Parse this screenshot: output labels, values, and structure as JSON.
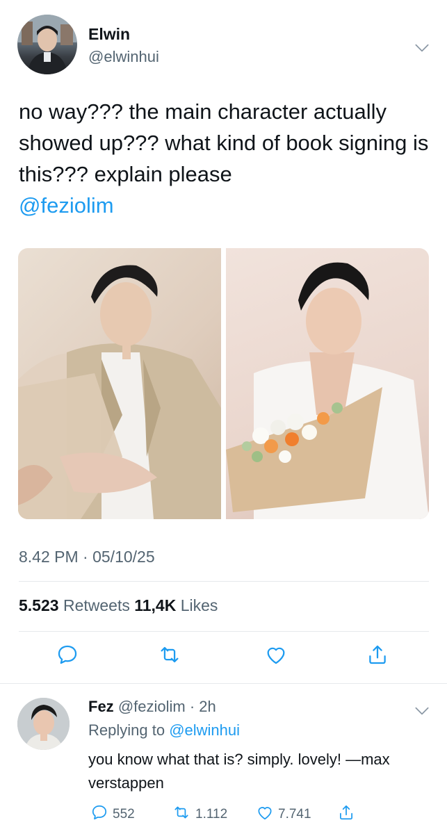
{
  "tweet": {
    "name": "Elwin",
    "handle": "@elwinhui",
    "text": "no way??? the main character actually showed up??? what kind of book signing is this??? explain please",
    "mention": "@feziolim",
    "timestamp": "8.42 PM · 05/10/25",
    "retweets_count": "5.523",
    "retweets_label": "Retweets",
    "likes_count": "11,4K",
    "likes_label": "Likes"
  },
  "reply": {
    "name": "Fez",
    "handle_time": "@feziolim · 2h",
    "replying_prefix": "Replying to",
    "replying_to": "@elwinhui",
    "text": "you know what that is? simply. lovely! —max verstappen",
    "comments": "552",
    "retweets": "1.112",
    "likes": "7.741"
  },
  "icons": [
    "chevron-down-icon",
    "comment-icon",
    "retweet-icon",
    "heart-icon",
    "share-icon"
  ],
  "colors": {
    "link": "#1d9bf0",
    "secondary_text": "#536471",
    "icon": "#1d9bf0",
    "divider": "#e6e9ec"
  }
}
